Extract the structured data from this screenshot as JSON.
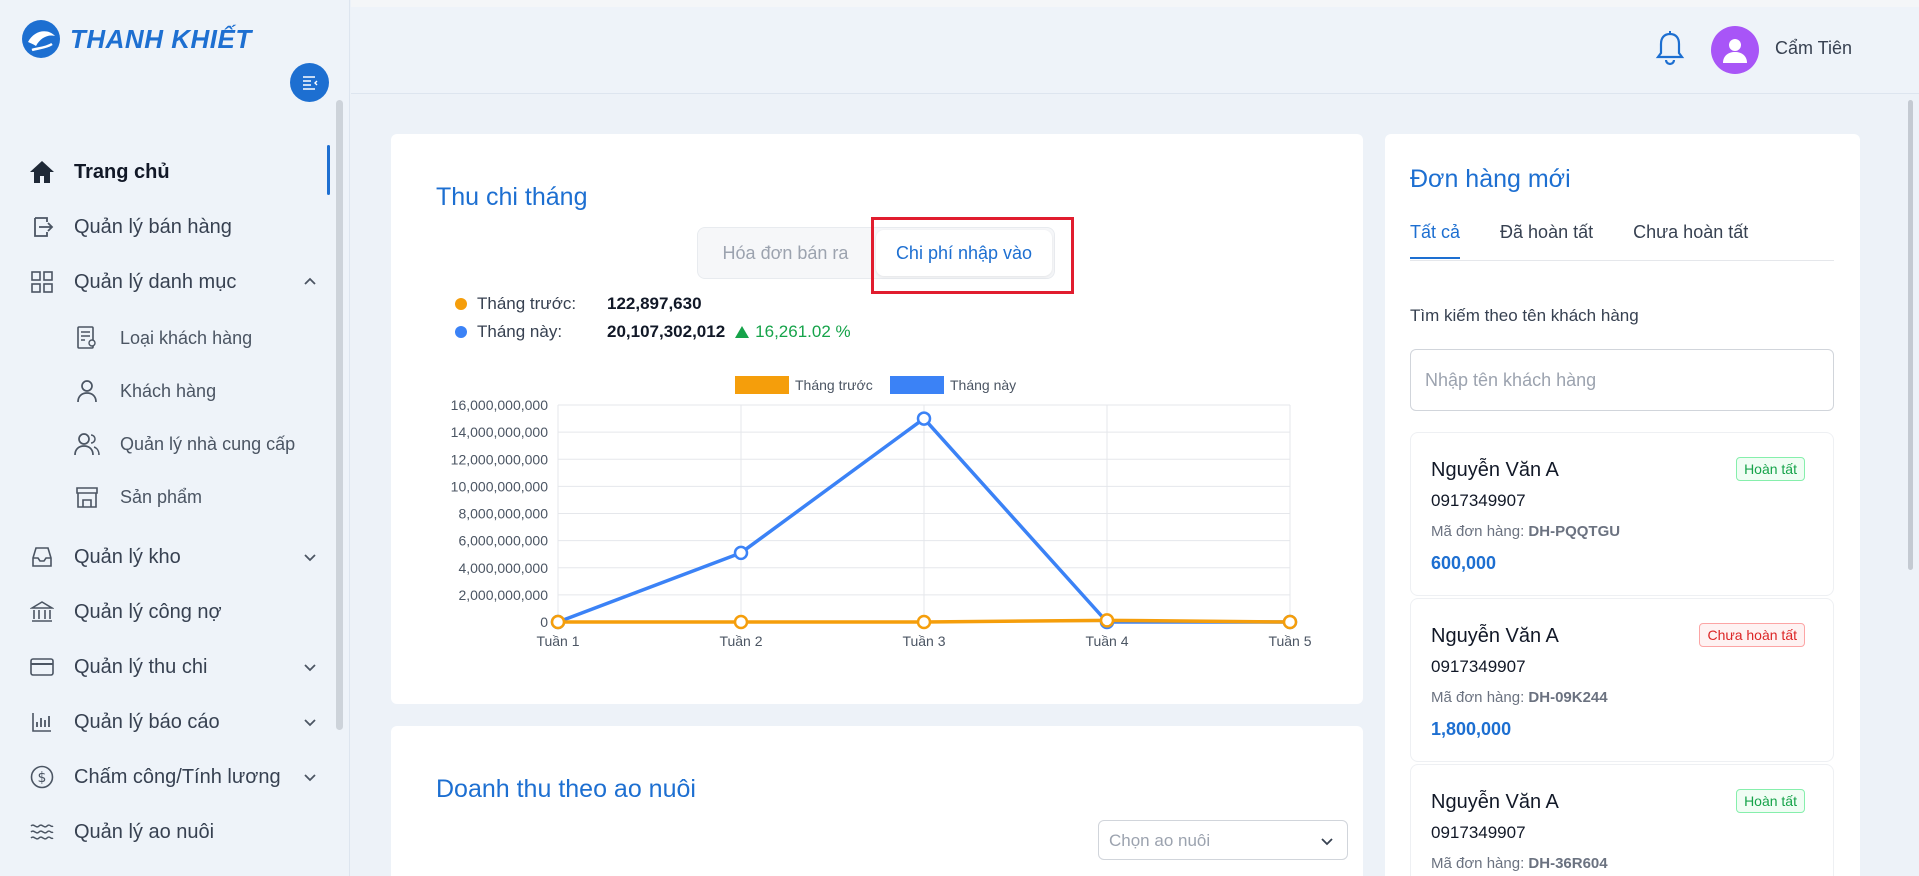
{
  "brand": {
    "name": "THANH KHIẾT"
  },
  "user": {
    "name": "Cẩm Tiên"
  },
  "nav": {
    "home": "Trang chủ",
    "sales": "Quản lý bán hàng",
    "catalog": "Quản lý danh mục",
    "catalog_sub": {
      "customer_types": "Loại khách hàng",
      "customers": "Khách hàng",
      "suppliers": "Quản lý nhà cung cấp",
      "products": "Sản phẩm"
    },
    "warehouse": "Quản lý kho",
    "debts": "Quản lý công nợ",
    "finance": "Quản lý thu chi",
    "reports": "Quản lý báo cáo",
    "payroll": "Chấm công/Tính lương",
    "ponds": "Quản lý ao nuôi"
  },
  "monthly": {
    "title": "Thu chi tháng",
    "toggle": {
      "sales_invoices": "Hóa đơn bán ra",
      "import_costs": "Chi phí nhập vào"
    },
    "last_month_label": "Tháng trước:",
    "last_month_value": "122,897,630",
    "this_month_label": "Tháng này:",
    "this_month_value": "20,107,302,012",
    "change_pct": "16,261.02 %"
  },
  "chart_data": {
    "type": "line",
    "categories": [
      "Tuần 1",
      "Tuần 2",
      "Tuần 3",
      "Tuần 4",
      "Tuần 5"
    ],
    "series": [
      {
        "name": "Tháng trước",
        "color": "#f59e0b",
        "values": [
          0,
          0,
          0,
          122897630,
          0
        ]
      },
      {
        "name": "Tháng này",
        "color": "#3b82f6",
        "values": [
          0,
          5100000000,
          15000000000,
          0,
          0
        ]
      }
    ],
    "ylim": [
      0,
      16000000000
    ],
    "yticks": [
      "0",
      "2,000,000,000",
      "4,000,000,000",
      "6,000,000,000",
      "8,000,000,000",
      "10,000,000,000",
      "12,000,000,000",
      "14,000,000,000",
      "16,000,000,000"
    ],
    "legend": "top",
    "grid": true
  },
  "pond_revenue": {
    "title": "Doanh thu theo ao nuôi",
    "select_placeholder": "Chọn ao nuôi"
  },
  "orders": {
    "title": "Đơn hàng mới",
    "tabs": [
      "Tất cả",
      "Đã hoàn tất",
      "Chưa hoàn tất"
    ],
    "search_label": "Tìm kiếm theo tên khách hàng",
    "search_placeholder": "Nhập tên khách hàng",
    "code_label": "Mã đơn hàng:",
    "items": [
      {
        "name": "Nguyễn Văn A",
        "phone": "0917349907",
        "code": "DH-PQQTGU",
        "price": "600,000",
        "status": "Hoàn tất"
      },
      {
        "name": "Nguyễn Văn A",
        "phone": "0917349907",
        "code": "DH-09K244",
        "price": "1,800,000",
        "status": "Chưa hoàn tất"
      },
      {
        "name": "Nguyễn Văn A",
        "phone": "0917349907",
        "code": "DH-36R604",
        "price": "",
        "status": "Hoàn tất"
      }
    ]
  }
}
